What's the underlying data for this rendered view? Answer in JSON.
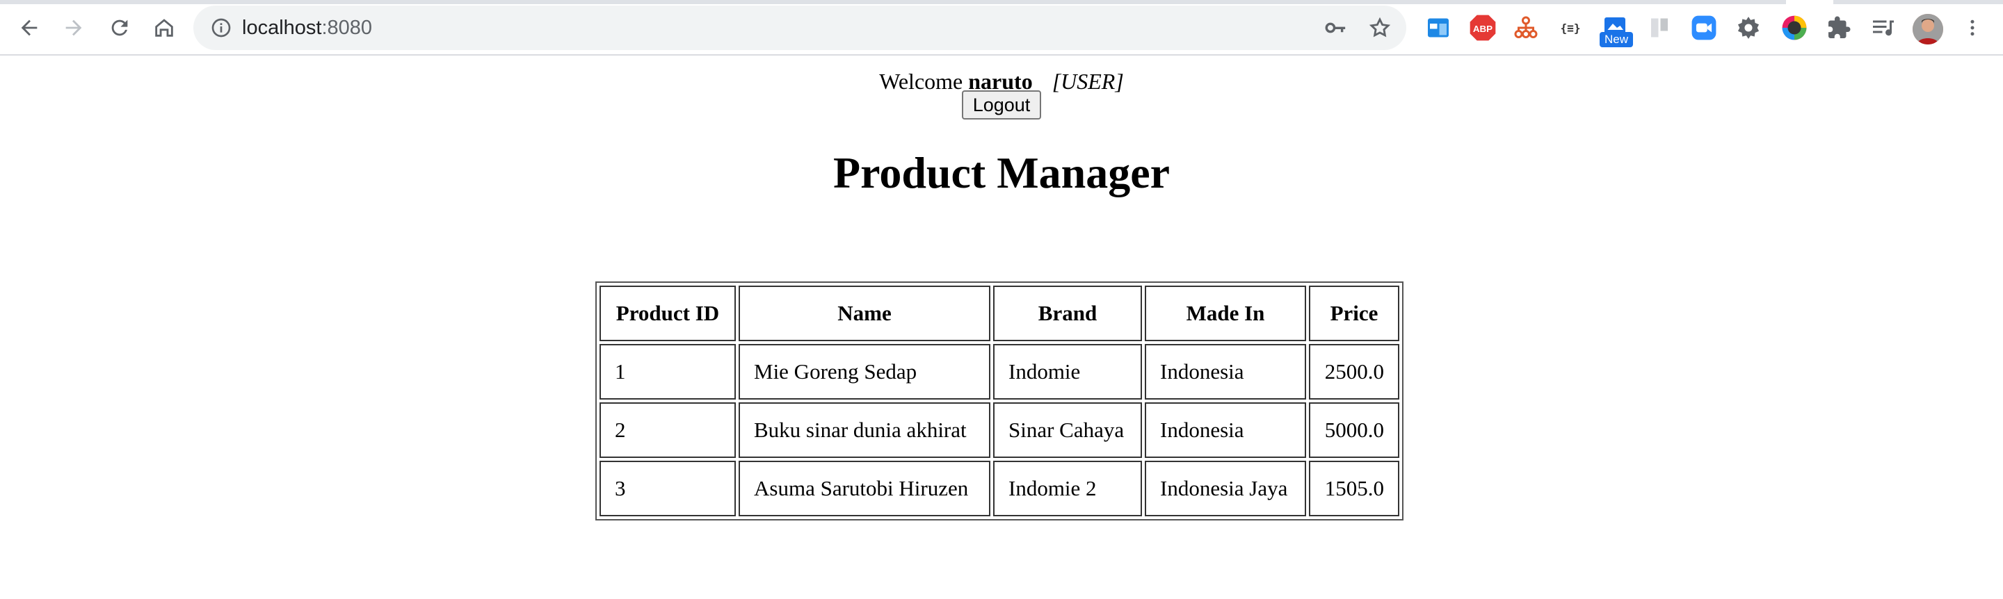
{
  "browser": {
    "url_host": "localhost",
    "url_port": ":8080",
    "new_badge": "New",
    "abp_label": "ABP",
    "json_ext_label": "{≡}"
  },
  "header": {
    "welcome_text": "Welcome",
    "username": "naruto",
    "role": "[USER]",
    "logout_label": "Logout"
  },
  "main": {
    "title": "Product Manager"
  },
  "table": {
    "headers": [
      "Product ID",
      "Name",
      "Brand",
      "Made In",
      "Price"
    ],
    "rows": [
      [
        "1",
        "Mie Goreng Sedap",
        "Indomie",
        "Indonesia",
        "2500.0"
      ],
      [
        "2",
        "Buku sinar dunia akhirat",
        "Sinar Cahaya",
        "Indonesia",
        "5000.0"
      ],
      [
        "3",
        "Asuma Sarutobi Hiruzen",
        "Indomie 2",
        "Indonesia Jaya",
        "1505.0"
      ]
    ]
  }
}
